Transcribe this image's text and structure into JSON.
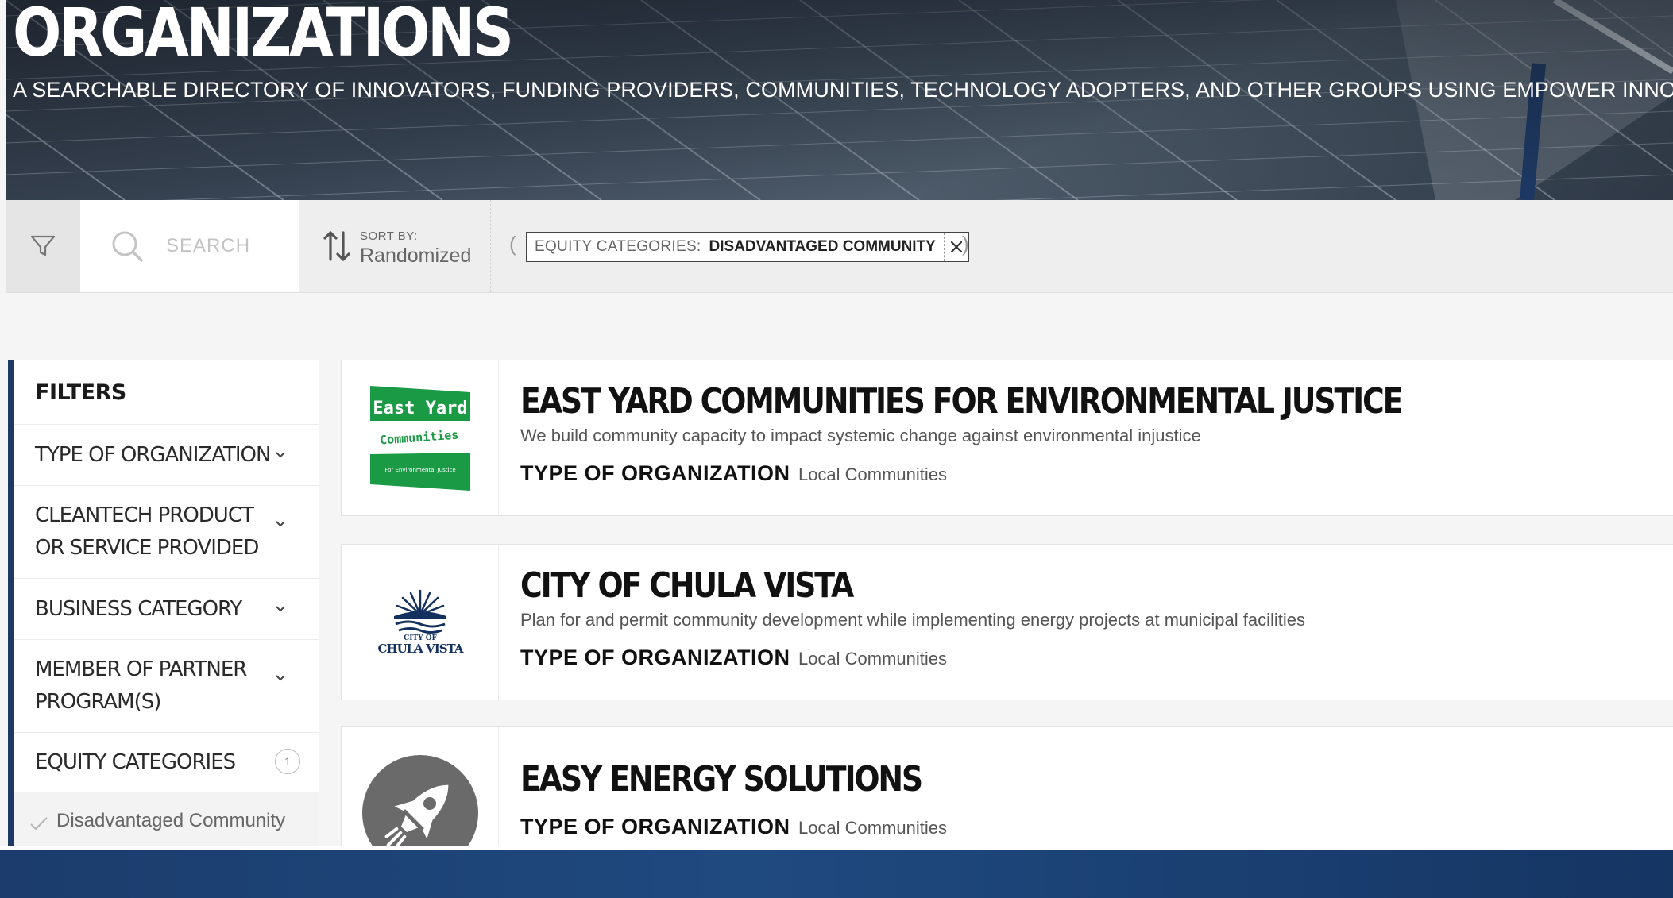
{
  "hero": {
    "title": "ORGANIZATIONS",
    "subtitle": "A SEARCHABLE DIRECTORY OF INNOVATORS, FUNDING PROVIDERS, COMMUNITIES, TECHNOLOGY ADOPTERS, AND OTHER GROUPS USING EMPOWER INNOVATION,"
  },
  "toolbar": {
    "search": {
      "placeholder": "SEARCH",
      "value": ""
    },
    "sort": {
      "label": "SORT BY:",
      "value": "Randomized"
    },
    "active_filter": {
      "open_paren": "(",
      "category": "EQUITY CATEGORIES:",
      "value": "DISADVANTAGED COMMUNITY",
      "close_paren": ")"
    }
  },
  "sidebar": {
    "title": "FILTERS",
    "items": [
      {
        "label": "TYPE OF ORGANIZATION"
      },
      {
        "label": "CLEANTECH PRODUCT OR SERVICE PROVIDED"
      },
      {
        "label": "BUSINESS CATEGORY"
      },
      {
        "label": "MEMBER OF PARTNER PROGRAM(S)"
      },
      {
        "label": "EQUITY CATEGORIES",
        "count": "1"
      }
    ],
    "selected_option": "Disadvantaged Community"
  },
  "organizations": [
    {
      "name": "EAST YARD COMMUNITIES FOR ENVIRONMENTAL JUSTICE",
      "description": "We build community capacity to impact systemic change against environmental injustice",
      "type_label": "TYPE OF ORGANIZATION",
      "type_value": "Local Communities",
      "logo": {
        "line1": "East Yard",
        "line2": "Communities",
        "line3": "For Environmental Justice"
      }
    },
    {
      "name": "CITY OF CHULA VISTA",
      "description": "Plan for and permit community development while implementing energy projects at municipal facilities",
      "type_label": "TYPE OF ORGANIZATION",
      "type_value": "Local Communities",
      "logo": {
        "line1": "CITY OF",
        "line2": "CHULA VISTA"
      }
    },
    {
      "name": "EASY ENERGY SOLUTIONS",
      "type_label": "TYPE OF ORGANIZATION",
      "type_value": "Local Communities",
      "logo": {
        "icon": "rocket-icon"
      }
    }
  ],
  "colors": {
    "sidebar_accent": "#1f3a62",
    "east_yard_green": "#1b9a45",
    "chula_navy": "#14305e",
    "bottom_bar": "#1b3c6c"
  }
}
